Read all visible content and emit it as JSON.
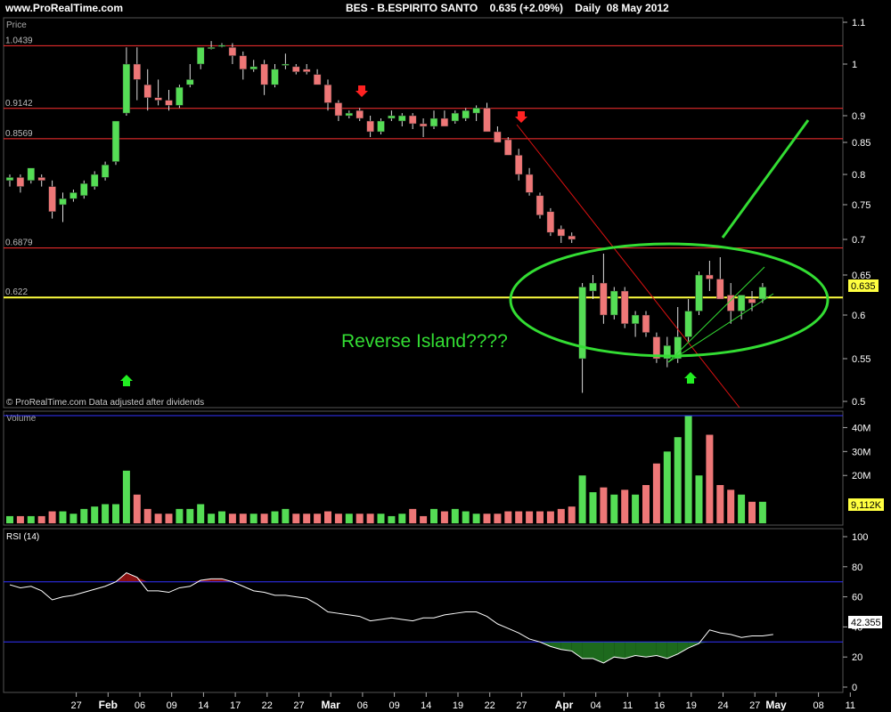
{
  "header": {
    "site": "www.ProRealTime.com",
    "title": "BES - B.ESPIRITO SANTO    0.635 (+2.09%)    Daily  08 May 2012"
  },
  "price_panel": {
    "label": "Price",
    "footer": "© ProRealTime.com  Data adjusted after dividends",
    "annotation": "Reverse Island????",
    "last_price_badge": "0.635",
    "hlines": [
      {
        "value": 1.0439,
        "label": "1.0439",
        "color": "#ff3030"
      },
      {
        "value": 0.9142,
        "label": "0.9142",
        "color": "#ff3030"
      },
      {
        "value": 0.8569,
        "label": "0.8569",
        "color": "#ff3030"
      },
      {
        "value": 0.6879,
        "label": "0.6879",
        "color": "#ff3030"
      },
      {
        "value": 0.622,
        "label": "0.622",
        "color": "#ffff40"
      }
    ],
    "yticks": [
      "1.1",
      "1",
      "0.9",
      "0.85",
      "0.8",
      "0.75",
      "0.7",
      "0.65",
      "0.6",
      "0.55",
      "0.5"
    ]
  },
  "volume_panel": {
    "label": "Volume",
    "yticks": [
      "40M",
      "30M",
      "20M"
    ],
    "last_badge": "9,112K"
  },
  "rsi_panel": {
    "label": "RSI (14)",
    "yticks": [
      "100",
      "80",
      "60",
      "40",
      "20",
      "0"
    ],
    "levels": [
      70,
      30
    ],
    "last_badge": "42.355"
  },
  "xaxis": {
    "ticks": [
      {
        "i": 4,
        "label": "27"
      },
      {
        "i": 7,
        "label": "Feb"
      },
      {
        "i": 10,
        "label": "06"
      },
      {
        "i": 13,
        "label": "09"
      },
      {
        "i": 16,
        "label": "14"
      },
      {
        "i": 19,
        "label": "17"
      },
      {
        "i": 22,
        "label": "22"
      },
      {
        "i": 25,
        "label": "27"
      },
      {
        "i": 28,
        "label": "Mar"
      },
      {
        "i": 31,
        "label": "06"
      },
      {
        "i": 34,
        "label": "09"
      },
      {
        "i": 37,
        "label": "14"
      },
      {
        "i": 40,
        "label": "19"
      },
      {
        "i": 43,
        "label": "22"
      },
      {
        "i": 46,
        "label": "27"
      },
      {
        "i": 50,
        "label": "Apr"
      },
      {
        "i": 53,
        "label": "04"
      },
      {
        "i": 56,
        "label": "11"
      },
      {
        "i": 59,
        "label": "16"
      },
      {
        "i": 62,
        "label": "19"
      },
      {
        "i": 65,
        "label": "24"
      },
      {
        "i": 68,
        "label": "27"
      },
      {
        "i": 70,
        "label": "May"
      },
      {
        "i": 74,
        "label": "08"
      },
      {
        "i": 77,
        "label": "11"
      }
    ]
  },
  "colors": {
    "up": "#55dd55",
    "down": "#ee7777",
    "annotation": "#33dd33",
    "trend_red": "#dd1111",
    "rsi_line": "#ffffff",
    "level_line": "#3333ff"
  },
  "chart_data": {
    "type": "candlestick",
    "title": "BES - B.ESPIRITO SANTO    0.635 (+2.09%)    Daily  08 May 2012",
    "candles": [
      {
        "o": 0.79,
        "h": 0.8,
        "l": 0.78,
        "c": 0.795,
        "v": 3
      },
      {
        "o": 0.795,
        "h": 0.8,
        "l": 0.77,
        "c": 0.78,
        "v": 3
      },
      {
        "o": 0.79,
        "h": 0.81,
        "l": 0.785,
        "c": 0.81,
        "v": 3
      },
      {
        "o": 0.795,
        "h": 0.8,
        "l": 0.78,
        "c": 0.79,
        "v": 3
      },
      {
        "o": 0.78,
        "h": 0.79,
        "l": 0.73,
        "c": 0.74,
        "v": 5
      },
      {
        "o": 0.75,
        "h": 0.77,
        "l": 0.725,
        "c": 0.76,
        "v": 5
      },
      {
        "o": 0.76,
        "h": 0.775,
        "l": 0.755,
        "c": 0.77,
        "v": 4
      },
      {
        "o": 0.765,
        "h": 0.79,
        "l": 0.76,
        "c": 0.785,
        "v": 6
      },
      {
        "o": 0.78,
        "h": 0.805,
        "l": 0.775,
        "c": 0.8,
        "v": 7
      },
      {
        "o": 0.795,
        "h": 0.82,
        "l": 0.79,
        "c": 0.815,
        "v": 8
      },
      {
        "o": 0.82,
        "h": 0.89,
        "l": 0.815,
        "c": 0.89,
        "v": 8
      },
      {
        "o": 0.905,
        "h": 1.04,
        "l": 0.9,
        "c": 1.0,
        "v": 22
      },
      {
        "o": 1.0,
        "h": 1.04,
        "l": 0.93,
        "c": 0.97,
        "v": 12
      },
      {
        "o": 0.96,
        "h": 0.99,
        "l": 0.91,
        "c": 0.935,
        "v": 6
      },
      {
        "o": 0.935,
        "h": 0.97,
        "l": 0.92,
        "c": 0.93,
        "v": 4
      },
      {
        "o": 0.93,
        "h": 0.95,
        "l": 0.91,
        "c": 0.92,
        "v": 4
      },
      {
        "o": 0.92,
        "h": 0.96,
        "l": 0.915,
        "c": 0.955,
        "v": 6
      },
      {
        "o": 0.96,
        "h": 1.0,
        "l": 0.955,
        "c": 0.97,
        "v": 6
      },
      {
        "o": 1.0,
        "h": 1.04,
        "l": 0.99,
        "c": 1.04,
        "v": 8
      },
      {
        "o": 1.04,
        "h": 1.055,
        "l": 1.035,
        "c": 1.04,
        "v": 4
      },
      {
        "o": 1.045,
        "h": 1.05,
        "l": 1.04,
        "c": 1.045,
        "v": 5
      },
      {
        "o": 1.04,
        "h": 1.05,
        "l": 1.0,
        "c": 1.02,
        "v": 4
      },
      {
        "o": 1.02,
        "h": 1.03,
        "l": 0.97,
        "c": 0.99,
        "v": 4
      },
      {
        "o": 0.99,
        "h": 1.01,
        "l": 0.985,
        "c": 0.995,
        "v": 4
      },
      {
        "o": 1.0,
        "h": 1.01,
        "l": 0.94,
        "c": 0.96,
        "v": 4
      },
      {
        "o": 0.96,
        "h": 1.0,
        "l": 0.955,
        "c": 0.99,
        "v": 5
      },
      {
        "o": 1.0,
        "h": 1.025,
        "l": 0.99,
        "c": 1.0,
        "v": 6
      },
      {
        "o": 0.995,
        "h": 1.0,
        "l": 0.98,
        "c": 0.985,
        "v": 4
      },
      {
        "o": 0.99,
        "h": 1.0,
        "l": 0.98,
        "c": 0.985,
        "v": 4
      },
      {
        "o": 0.98,
        "h": 0.99,
        "l": 0.96,
        "c": 0.96,
        "v": 4
      },
      {
        "o": 0.96,
        "h": 0.97,
        "l": 0.91,
        "c": 0.925,
        "v": 5
      },
      {
        "o": 0.925,
        "h": 0.93,
        "l": 0.89,
        "c": 0.9,
        "v": 4
      },
      {
        "o": 0.9,
        "h": 0.91,
        "l": 0.895,
        "c": 0.905,
        "v": 4
      },
      {
        "o": 0.91,
        "h": 0.915,
        "l": 0.89,
        "c": 0.895,
        "v": 4
      },
      {
        "o": 0.89,
        "h": 0.9,
        "l": 0.86,
        "c": 0.87,
        "v": 4
      },
      {
        "o": 0.87,
        "h": 0.895,
        "l": 0.865,
        "c": 0.89,
        "v": 4
      },
      {
        "o": 0.895,
        "h": 0.91,
        "l": 0.89,
        "c": 0.9,
        "v": 3
      },
      {
        "o": 0.89,
        "h": 0.905,
        "l": 0.88,
        "c": 0.9,
        "v": 4
      },
      {
        "o": 0.9,
        "h": 0.905,
        "l": 0.875,
        "c": 0.885,
        "v": 6
      },
      {
        "o": 0.885,
        "h": 0.895,
        "l": 0.86,
        "c": 0.88,
        "v": 3
      },
      {
        "o": 0.88,
        "h": 0.91,
        "l": 0.875,
        "c": 0.895,
        "v": 6
      },
      {
        "o": 0.895,
        "h": 0.91,
        "l": 0.88,
        "c": 0.88,
        "v": 5
      },
      {
        "o": 0.89,
        "h": 0.91,
        "l": 0.885,
        "c": 0.905,
        "v": 6
      },
      {
        "o": 0.895,
        "h": 0.915,
        "l": 0.89,
        "c": 0.91,
        "v": 5
      },
      {
        "o": 0.905,
        "h": 0.92,
        "l": 0.89,
        "c": 0.915,
        "v": 4
      },
      {
        "o": 0.915,
        "h": 0.925,
        "l": 0.89,
        "c": 0.87,
        "v": 4
      },
      {
        "o": 0.87,
        "h": 0.88,
        "l": 0.85,
        "c": 0.85,
        "v": 4
      },
      {
        "o": 0.855,
        "h": 0.86,
        "l": 0.83,
        "c": 0.83,
        "v": 5
      },
      {
        "o": 0.83,
        "h": 0.84,
        "l": 0.79,
        "c": 0.8,
        "v": 5
      },
      {
        "o": 0.8,
        "h": 0.81,
        "l": 0.765,
        "c": 0.77,
        "v": 5
      },
      {
        "o": 0.765,
        "h": 0.77,
        "l": 0.73,
        "c": 0.735,
        "v": 5
      },
      {
        "o": 0.74,
        "h": 0.745,
        "l": 0.705,
        "c": 0.71,
        "v": 5
      },
      {
        "o": 0.715,
        "h": 0.72,
        "l": 0.695,
        "c": 0.705,
        "v": 6
      },
      {
        "o": 0.705,
        "h": 0.71,
        "l": 0.695,
        "c": 0.7,
        "v": 7
      },
      {
        "o": 0.55,
        "h": 0.64,
        "l": 0.51,
        "c": 0.635,
        "v": 20
      },
      {
        "o": 0.63,
        "h": 0.65,
        "l": 0.62,
        "c": 0.64,
        "v": 13
      },
      {
        "o": 0.64,
        "h": 0.68,
        "l": 0.59,
        "c": 0.6,
        "v": 15
      },
      {
        "o": 0.6,
        "h": 0.635,
        "l": 0.595,
        "c": 0.63,
        "v": 12
      },
      {
        "o": 0.63,
        "h": 0.635,
        "l": 0.585,
        "c": 0.59,
        "v": 14
      },
      {
        "o": 0.59,
        "h": 0.605,
        "l": 0.575,
        "c": 0.6,
        "v": 12
      },
      {
        "o": 0.6,
        "h": 0.605,
        "l": 0.575,
        "c": 0.58,
        "v": 16
      },
      {
        "o": 0.575,
        "h": 0.58,
        "l": 0.545,
        "c": 0.55,
        "v": 25
      },
      {
        "o": 0.55,
        "h": 0.575,
        "l": 0.54,
        "c": 0.565,
        "v": 30
      },
      {
        "o": 0.55,
        "h": 0.61,
        "l": 0.545,
        "c": 0.575,
        "v": 36
      },
      {
        "o": 0.575,
        "h": 0.62,
        "l": 0.57,
        "c": 0.605,
        "v": 45
      },
      {
        "o": 0.605,
        "h": 0.655,
        "l": 0.6,
        "c": 0.65,
        "v": 20
      },
      {
        "o": 0.65,
        "h": 0.67,
        "l": 0.63,
        "c": 0.645,
        "v": 37
      },
      {
        "o": 0.645,
        "h": 0.675,
        "l": 0.63,
        "c": 0.62,
        "v": 16
      },
      {
        "o": 0.625,
        "h": 0.64,
        "l": 0.59,
        "c": 0.605,
        "v": 14
      },
      {
        "o": 0.605,
        "h": 0.625,
        "l": 0.595,
        "c": 0.625,
        "v": 12
      },
      {
        "o": 0.62,
        "h": 0.63,
        "l": 0.605,
        "c": 0.615,
        "v": 9
      },
      {
        "o": 0.62,
        "h": 0.64,
        "l": 0.615,
        "c": 0.635,
        "v": 9
      }
    ],
    "rsi": [
      68,
      66,
      67,
      64,
      58,
      60,
      61,
      63,
      65,
      67,
      70,
      76,
      73,
      64,
      64,
      63,
      66,
      67,
      71,
      72,
      72,
      70,
      67,
      64,
      63,
      61,
      61,
      60,
      59,
      55,
      50,
      49,
      48,
      47,
      44,
      45,
      46,
      45,
      44,
      46,
      46,
      48,
      49,
      50,
      50,
      47,
      42,
      39,
      36,
      32,
      30,
      27,
      25,
      24,
      19,
      19,
      16,
      20,
      19,
      21,
      20,
      21,
      19,
      22,
      26,
      29,
      38,
      36,
      35,
      33,
      34,
      34,
      35
    ]
  }
}
